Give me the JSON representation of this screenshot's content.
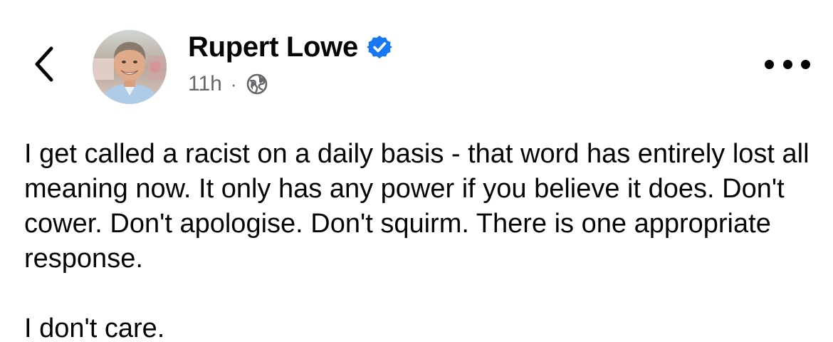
{
  "header": {
    "back_icon": "chevron-left-icon",
    "author_name": "Rupert Lowe",
    "verified_icon": "verified-badge-icon",
    "verified_color": "#1877f2",
    "timestamp": "11h",
    "separator": "·",
    "audience_icon": "globe-icon",
    "more_icon": "more-options-icon"
  },
  "post": {
    "paragraph_1": "I get called a racist on a daily basis - that word has entirely lost all meaning now. It only has any power if you believe it does. Don't cower. Don't apologise. Don't squirm. There is one appropriate response.",
    "paragraph_2": "I don't care."
  },
  "colors": {
    "text": "#050505",
    "secondary_text": "#65676b",
    "background": "#ffffff"
  }
}
